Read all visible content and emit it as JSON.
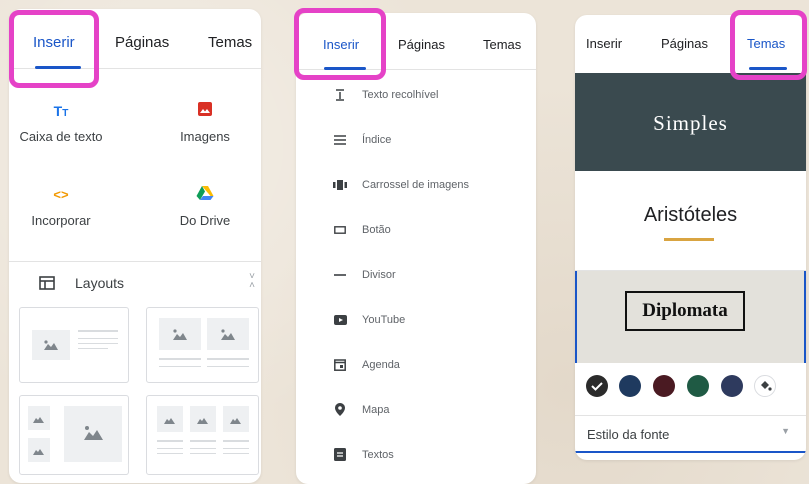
{
  "panel_insert": {
    "tabs": [
      {
        "label": "Inserir"
      },
      {
        "label": "Páginas"
      },
      {
        "label": "Temas"
      }
    ],
    "items": [
      {
        "label": "Caixa de texto",
        "icon": "text-box-icon"
      },
      {
        "label": "Imagens",
        "icon": "image-icon"
      },
      {
        "label": "Incorporar",
        "icon": "embed-icon"
      },
      {
        "label": "Do Drive",
        "icon": "drive-icon"
      }
    ],
    "layouts_label": "Layouts"
  },
  "panel_list": {
    "tabs": [
      {
        "label": "Inserir"
      },
      {
        "label": "Páginas"
      },
      {
        "label": "Temas"
      }
    ],
    "items": [
      {
        "label": "Texto recolhível",
        "icon": "collapsible-text-icon"
      },
      {
        "label": "Índice",
        "icon": "table-of-contents-icon"
      },
      {
        "label": "Carrossel de imagens",
        "icon": "carousel-icon"
      },
      {
        "label": "Botão",
        "icon": "button-icon"
      },
      {
        "label": "Divisor",
        "icon": "divider-icon"
      },
      {
        "label": "YouTube",
        "icon": "youtube-icon"
      },
      {
        "label": "Agenda",
        "icon": "calendar-icon"
      },
      {
        "label": "Mapa",
        "icon": "map-pin-icon"
      },
      {
        "label": "Textos",
        "icon": "docs-icon"
      }
    ]
  },
  "panel_themes": {
    "tabs": [
      {
        "label": "Inserir"
      },
      {
        "label": "Páginas"
      },
      {
        "label": "Temas"
      }
    ],
    "themes": [
      {
        "name": "Simples"
      },
      {
        "name": "Aristóteles"
      },
      {
        "name": "Diplomata"
      }
    ],
    "swatches": [
      "#2b2b2b",
      "#1f3a5f",
      "#4a1a22",
      "#1f5a44",
      "#2e3a5e"
    ],
    "font_style_label": "Estilo da fonte"
  },
  "colors": {
    "accent": "#1a56c8",
    "highlight": "#e542c7",
    "simples_bg": "#3a4a4f",
    "diplomata_bg": "#e3e1db",
    "aristoteles_underline": "#d9a441"
  }
}
